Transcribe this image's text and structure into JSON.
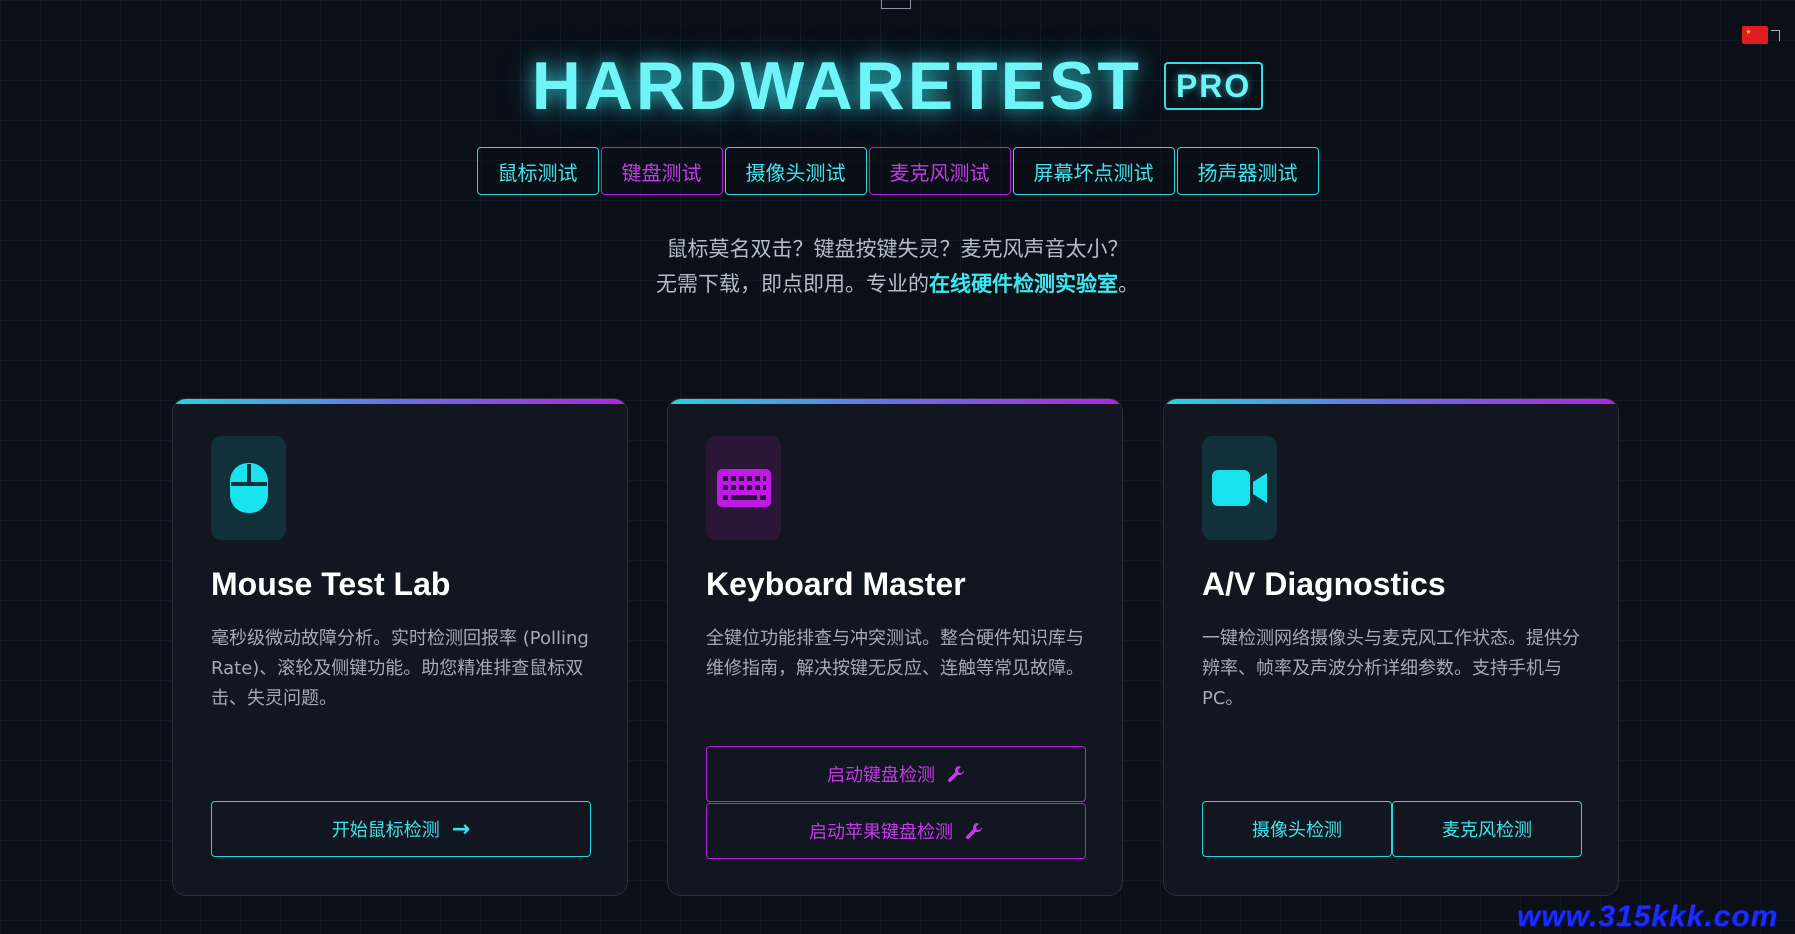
{
  "header": {
    "brand": "HARDWARETEST",
    "badge": "PRO",
    "language_flag_icon": "china-flag-icon"
  },
  "nav": {
    "items": [
      {
        "label": "鼠标测试",
        "color": "#27d7e0"
      },
      {
        "label": "键盘测试",
        "color": "#b51ee0"
      },
      {
        "label": "摄像头测试",
        "color": "#27d7e0"
      },
      {
        "label": "麦克风测试",
        "color": "#b51ee0"
      },
      {
        "label": "屏幕坏点测试",
        "color": "#27d7e0"
      },
      {
        "label": "扬声器测试",
        "color": "#27d7e0"
      }
    ]
  },
  "tagline": {
    "line1": "鼠标莫名双击？键盘按键失灵？麦克风声音太小？",
    "line2_prefix": "无需下载，即点即用。专业的",
    "line2_highlight": "在线硬件检测实验室",
    "line2_suffix": "。"
  },
  "cards": [
    {
      "icon": "mouse-icon",
      "title": "Mouse Test Lab",
      "description": "毫秒级微动故障分析。实时检测回报率 (Polling Rate)、滚轮及侧键功能。助您精准排查鼠标双击、失灵问题。",
      "buttons": [
        {
          "label": "开始鼠标检测",
          "icon": "arrow-right-icon"
        }
      ]
    },
    {
      "icon": "keyboard-icon",
      "title": "Keyboard Master",
      "description": "全键位功能排查与冲突测试。整合硬件知识库与维修指南，解决按键无反应、连触等常见故障。",
      "buttons": [
        {
          "label": "启动键盘检测",
          "icon": "wrench-icon"
        },
        {
          "label": "启动苹果键盘检测",
          "icon": "wrench-icon"
        }
      ]
    },
    {
      "icon": "video-camera-icon",
      "title": "A/V Diagnostics",
      "description": "一键检测网络摄像头与麦克风工作状态。提供分辨率、帧率及声波分析详细参数。支持手机与PC。",
      "buttons": [
        {
          "label": "摄像头检测"
        },
        {
          "label": "麦克风检测"
        }
      ]
    }
  ],
  "watermark": "www.315kkk.com",
  "colors": {
    "accent_cyan": "#27d7e0",
    "accent_magenta": "#b51ee0",
    "background": "#0a0f18"
  }
}
